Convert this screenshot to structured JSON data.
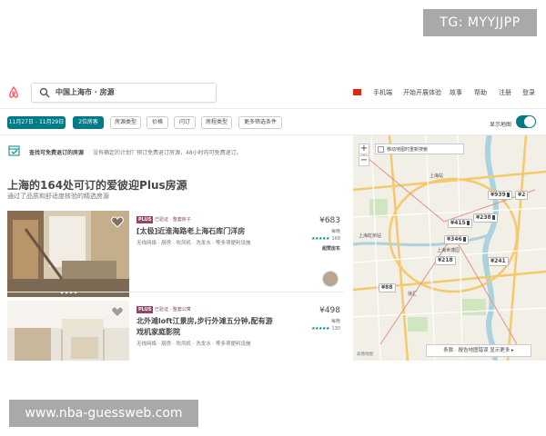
{
  "watermarks": {
    "top": "TG: MYYJJPP",
    "bottom": "www.nba-guessweb.com"
  },
  "header": {
    "logo_icon": "airbnb-logo-icon",
    "search_text": "中国上海市 · 房源",
    "nav": [
      "手机端",
      "开始开展体验",
      "故事",
      "帮助",
      "注册",
      "登录"
    ]
  },
  "filters": {
    "chips": [
      "11月27日 - 11月29日",
      "2位房客",
      "房源类型",
      "价格",
      "闪订",
      "房程类型",
      "更多筛选条件"
    ],
    "map_toggle_label": "显示地图"
  },
  "notice": {
    "bold": "查找可免费退订的房源",
    "rest": "没有确定的计划？预订免费退订房源，48小时内可免费退订。"
  },
  "section": {
    "title": "上海的164处可订的爱彼迎Plus房源",
    "subtitle": "通过了品质和舒适度核验的精选房源"
  },
  "listings": [
    {
      "badge": "PLUS",
      "kind": "已验证 · 整套房子",
      "title": "[太极]近淮海路老上海石库门洋房",
      "amenities": "无线网络 · 厨房 · 吹风机 · 洗发水 · 等多项便利设施",
      "price": "¥683",
      "per": "每晚",
      "stars": "★★★★★",
      "reviews": "168",
      "superhost": "超赞房东"
    },
    {
      "badge": "PLUS",
      "kind": "已验证 · 整套公寓",
      "title": "北外滩loft江景房,步行外滩五分钟,配有游戏机家庭影院",
      "amenities": "无线网络 · 厨房 · 吹风机 · 洗发水 · 等多项便利设施",
      "price": "¥498",
      "per": "每晚",
      "stars": "★★★★★",
      "reviews": "130",
      "superhost": ""
    }
  ],
  "map": {
    "checkbox_label": "移动地图时重新搜索",
    "zoom_in": "+",
    "zoom_out": "−",
    "pins": [
      "¥939",
      "¥2",
      "¥238",
      "¥415",
      "¥346",
      "¥218",
      "¥241",
      "¥88"
    ],
    "places": [
      "上海虹桥站",
      "上海世博园",
      "上海站",
      "徐汇"
    ],
    "report_link": "条款 · 报告地图错误  显示更多 ▸",
    "attribution": "高德地图"
  },
  "colors": {
    "accent": "#007a87",
    "plus": "#914669",
    "brand": "#ff5a5f"
  }
}
